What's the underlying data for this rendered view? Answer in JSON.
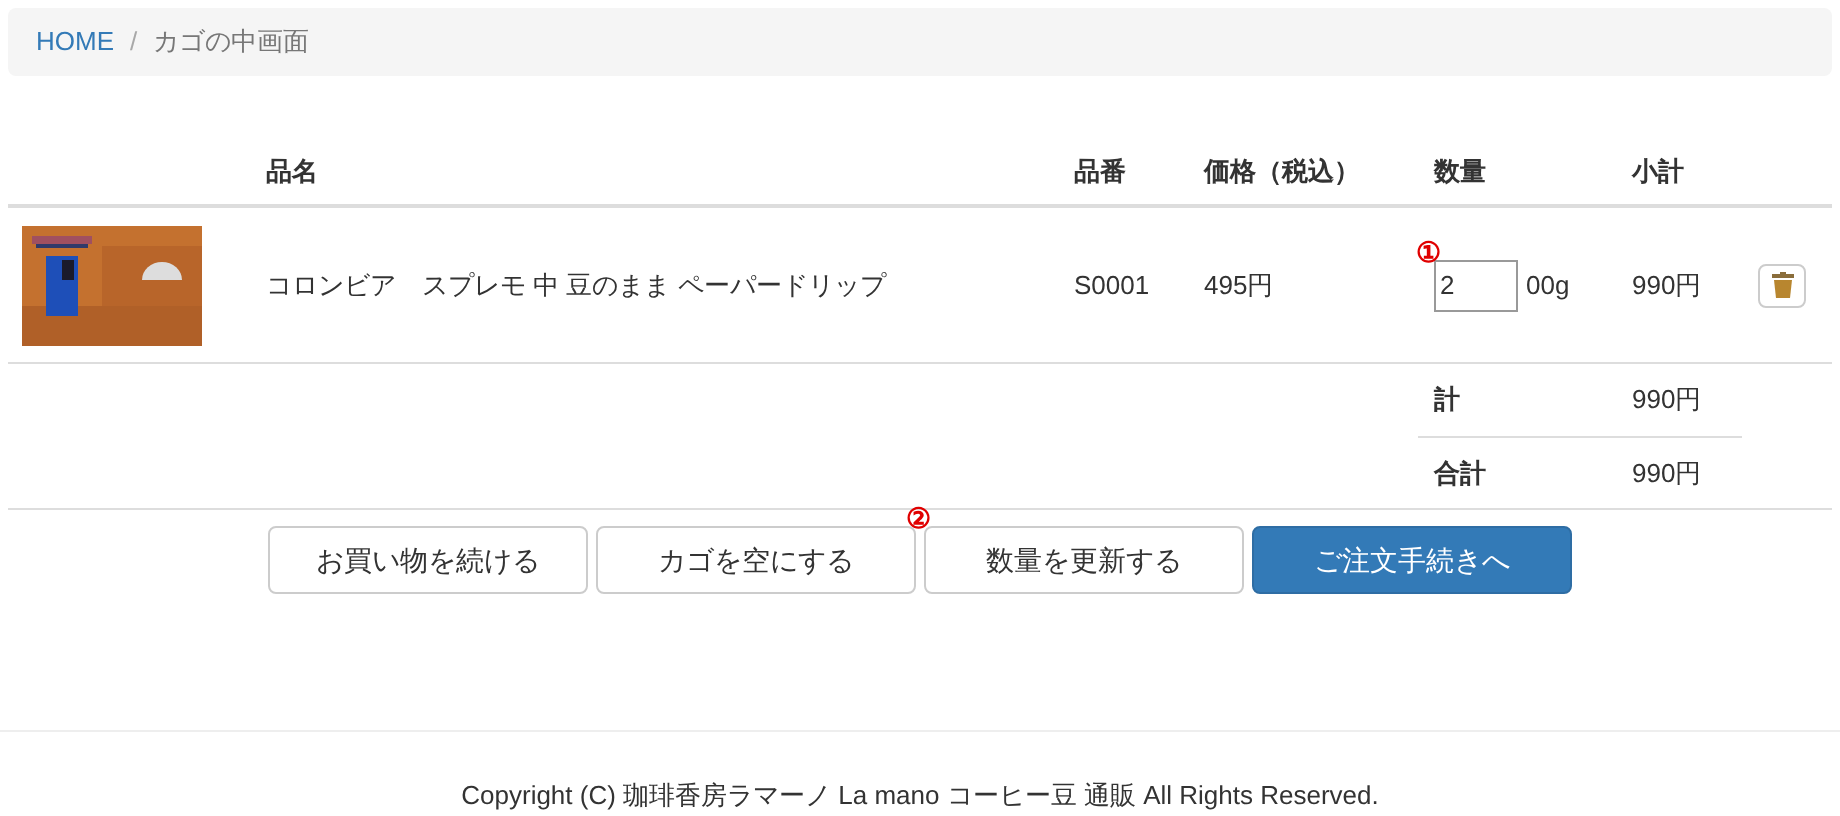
{
  "breadcrumb_separator": "/",
  "breadcrumb": [
    {
      "label": "HOME",
      "kind": "link"
    },
    {
      "label": "カゴの中画面",
      "kind": "current"
    }
  ],
  "table": {
    "columns": [
      "品名",
      "品番",
      "価格（税込）",
      "数量",
      "小計"
    ],
    "rows": [
      {
        "name": "コロンビア　スプレモ 中 豆のまま ペーパードリップ",
        "code": "S0001",
        "price": "495円",
        "quantity": "2",
        "unit": "00g",
        "subtotal": "990円",
        "marker": "①"
      }
    ]
  },
  "totals": [
    {
      "label": "計",
      "value": "990円"
    },
    {
      "label": "合計",
      "value": "990円"
    }
  ],
  "buttons": [
    {
      "label": "お買い物を続ける",
      "kind": "default"
    },
    {
      "label": "カゴを空にする",
      "kind": "default"
    },
    {
      "label": "数量を更新する",
      "kind": "default",
      "marker": "②"
    },
    {
      "label": "ご注文手続きへ",
      "kind": "primary"
    }
  ],
  "footer": "Copyright (C) 珈琲香房ラマーノ La mano コーヒー豆 通販 All Rights Reserved."
}
